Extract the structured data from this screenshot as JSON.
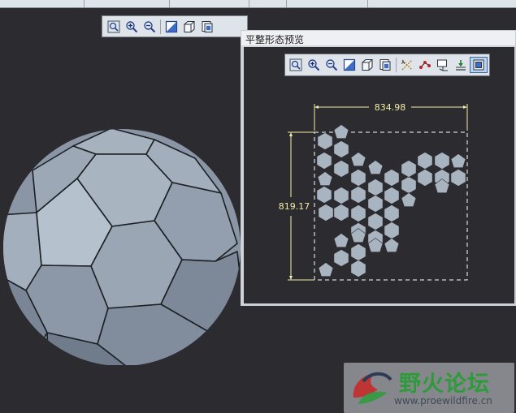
{
  "preview_window": {
    "title": "平整形态预览"
  },
  "dimensions": {
    "width_value": "834.98",
    "height_value": "819.17"
  },
  "main_toolbar": {
    "items": [
      "zoom-fit-icon",
      "zoom-in-icon",
      "zoom-out-icon",
      "repaint-icon",
      "view-orientation-icon",
      "saved-views-icon"
    ]
  },
  "preview_toolbar": {
    "items": [
      "zoom-fit-icon",
      "zoom-in-icon",
      "zoom-out-icon",
      "repaint-icon",
      "view-orientation-icon",
      "saved-views-icon",
      "axis-display-icon",
      "datum-points-icon",
      "coordinate-system-icon",
      "spin-center-icon",
      "annotation-display-icon"
    ]
  },
  "watermark": {
    "cn_text": "野火论坛",
    "url": "www.proewildfire.cn"
  },
  "colors": {
    "background": "#2b2b30",
    "model_face": "#9aa6b4",
    "model_face_light": "#b4bfcc",
    "dimension": "#f3efa8",
    "watermark_green": "#2e9b3a"
  }
}
